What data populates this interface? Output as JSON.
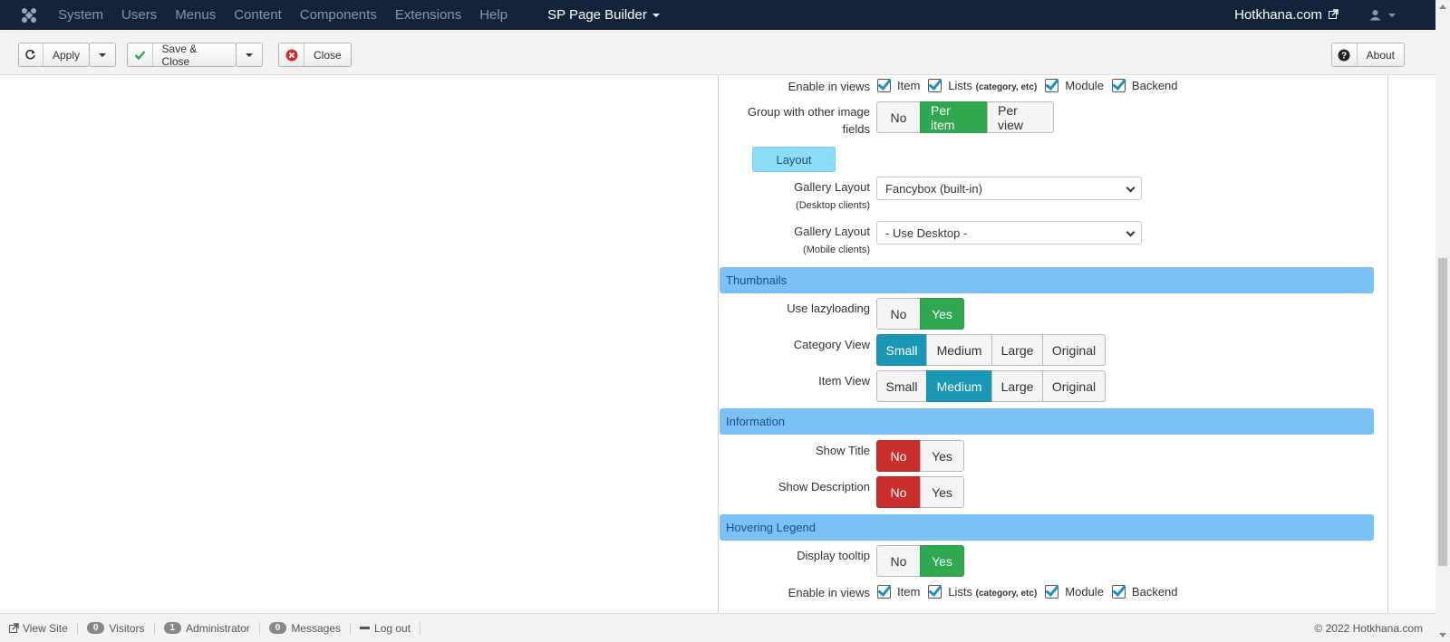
{
  "topnav": {
    "menu": [
      "System",
      "Users",
      "Menus",
      "Content",
      "Components",
      "Extensions",
      "Help"
    ],
    "active": "SP Page Builder",
    "site": "Hotkhana.com"
  },
  "toolbar": {
    "apply": "Apply",
    "save_close": "Save & Close",
    "close": "Close",
    "about": "About"
  },
  "form": {
    "enable_views_label": "Enable in views",
    "views": {
      "item": "Item",
      "lists": "Lists",
      "lists_note": "(category, etc)",
      "module": "Module",
      "backend": "Backend"
    },
    "group_label": "Group with other image fields",
    "group_options": [
      "No",
      "Per item",
      "Per view"
    ],
    "layout_button": "Layout",
    "gallery_desktop_label": "Gallery Layout",
    "gallery_desktop_note": "(Desktop clients)",
    "gallery_desktop_value": "Fancybox (built-in)",
    "gallery_mobile_label": "Gallery Layout",
    "gallery_mobile_note": "(Mobile clients)",
    "gallery_mobile_value": "- Use Desktop -",
    "section_thumbnails": "Thumbnails",
    "lazy_label": "Use lazyloading",
    "no": "No",
    "yes": "Yes",
    "category_view_label": "Category View",
    "item_view_label": "Item View",
    "sizes": [
      "Small",
      "Medium",
      "Large",
      "Original"
    ],
    "section_information": "Information",
    "show_title_label": "Show Title",
    "show_desc_label": "Show Description",
    "section_hover": "Hovering Legend",
    "tooltip_label": "Display tooltip"
  },
  "status": {
    "view_site": "View Site",
    "visitors_count": "0",
    "visitors": "Visitors",
    "admin_count": "1",
    "admin": "Administrator",
    "messages_count": "0",
    "messages": "Messages",
    "logout": "Log out",
    "copyright": "© 2022 Hotkhana.com"
  },
  "colors": {
    "nav_bg": "#14233c",
    "green": "#2fa84f",
    "red": "#c9302c",
    "blue": "#1997b5",
    "section": "#7cc1f5"
  }
}
